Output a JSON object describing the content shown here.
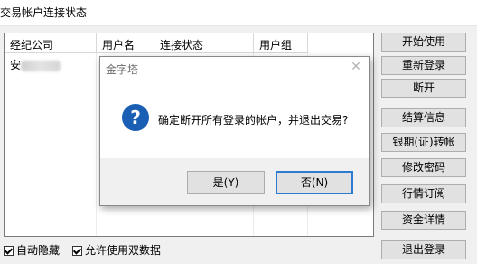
{
  "window": {
    "title": "交易帐户连接状态"
  },
  "table": {
    "columns": [
      "经纪公司",
      "用户名",
      "连接状态",
      "用户组"
    ],
    "rows": [
      {
        "broker": "安",
        "user": "",
        "status": "",
        "group": ""
      }
    ]
  },
  "side_buttons": [
    "开始使用",
    "重新登录",
    "断开",
    "结算信息",
    "银期(证)转帐",
    "修改密码",
    "行情订阅",
    "资金详情",
    "退出登录"
  ],
  "checkboxes": [
    {
      "label": "自动隐藏",
      "checked": true
    },
    {
      "label": "允许使用双数据",
      "checked": true
    }
  ],
  "dialog": {
    "title": "金字塔",
    "close": "✕",
    "icon_glyph": "?",
    "message": "确定断开所有登录的帐户，并退出交易?",
    "yes": "是(Y)",
    "no": "否(N)"
  },
  "colors": {
    "accent": "#2b7bd1",
    "icon_blue": "#1a5fb4"
  }
}
